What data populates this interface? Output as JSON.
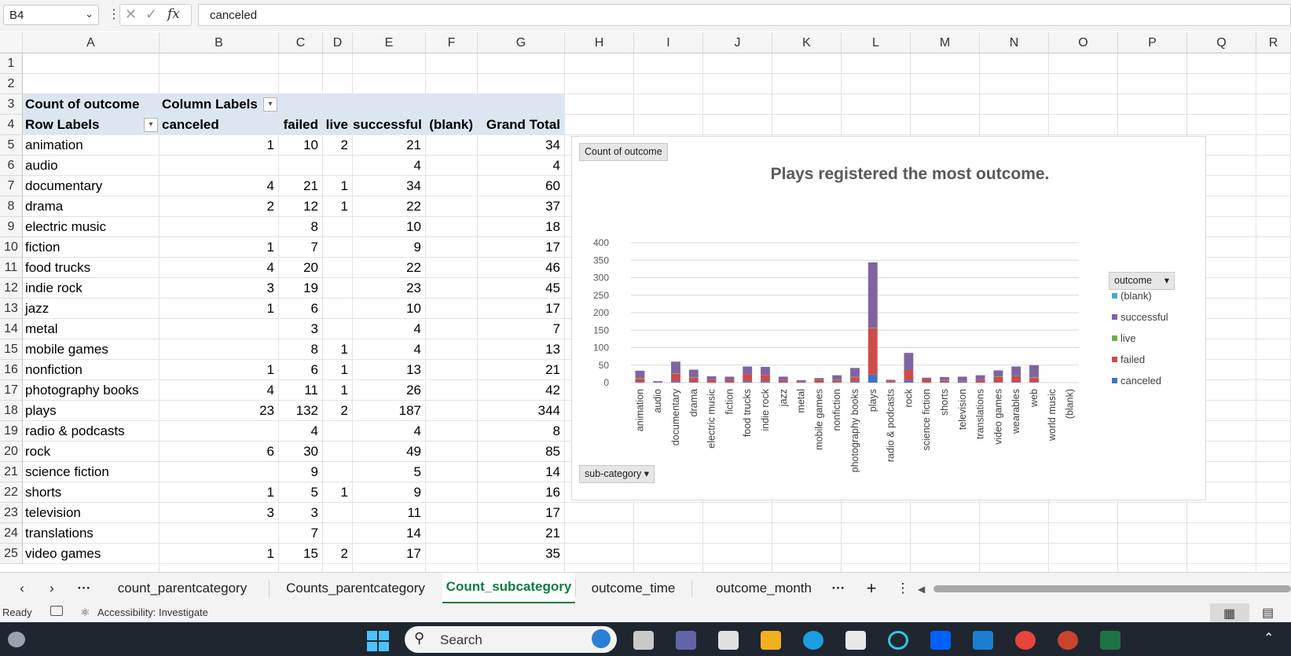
{
  "formula_bar": {
    "name_box": "B4",
    "value": "canceled"
  },
  "columns": [
    "A",
    "B",
    "C",
    "D",
    "E",
    "F",
    "G",
    "H",
    "I",
    "J",
    "K",
    "L",
    "M",
    "N",
    "O",
    "P",
    "Q",
    "R"
  ],
  "rows": [
    "1",
    "2",
    "3",
    "4",
    "5",
    "6",
    "7",
    "8",
    "9",
    "10",
    "11",
    "12",
    "13",
    "14",
    "15",
    "16",
    "17",
    "18",
    "19",
    "20",
    "21",
    "22",
    "23",
    "24",
    "25"
  ],
  "pivot": {
    "a3": "Count of outcome",
    "b3": "Column Labels",
    "a4": "Row Labels",
    "headers": [
      "canceled",
      "failed",
      "live",
      "successful",
      "(blank)",
      "Grand Total"
    ],
    "data": [
      {
        "label": "animation",
        "canceled": "1",
        "failed": "10",
        "live": "2",
        "successful": "21",
        "total": "34"
      },
      {
        "label": "audio",
        "canceled": "",
        "failed": "",
        "live": "",
        "successful": "4",
        "total": "4"
      },
      {
        "label": "documentary",
        "canceled": "4",
        "failed": "21",
        "live": "1",
        "successful": "34",
        "total": "60"
      },
      {
        "label": "drama",
        "canceled": "2",
        "failed": "12",
        "live": "1",
        "successful": "22",
        "total": "37"
      },
      {
        "label": "electric music",
        "canceled": "",
        "failed": "8",
        "live": "",
        "successful": "10",
        "total": "18"
      },
      {
        "label": "fiction",
        "canceled": "1",
        "failed": "7",
        "live": "",
        "successful": "9",
        "total": "17"
      },
      {
        "label": "food trucks",
        "canceled": "4",
        "failed": "20",
        "live": "",
        "successful": "22",
        "total": "46"
      },
      {
        "label": "indie rock",
        "canceled": "3",
        "failed": "19",
        "live": "",
        "successful": "23",
        "total": "45"
      },
      {
        "label": "jazz",
        "canceled": "1",
        "failed": "6",
        "live": "",
        "successful": "10",
        "total": "17"
      },
      {
        "label": "metal",
        "canceled": "",
        "failed": "3",
        "live": "",
        "successful": "4",
        "total": "7"
      },
      {
        "label": "mobile games",
        "canceled": "",
        "failed": "8",
        "live": "1",
        "successful": "4",
        "total": "13"
      },
      {
        "label": "nonfiction",
        "canceled": "1",
        "failed": "6",
        "live": "1",
        "successful": "13",
        "total": "21"
      },
      {
        "label": "photography books",
        "canceled": "4",
        "failed": "11",
        "live": "1",
        "successful": "26",
        "total": "42"
      },
      {
        "label": "plays",
        "canceled": "23",
        "failed": "132",
        "live": "2",
        "successful": "187",
        "total": "344"
      },
      {
        "label": "radio & podcasts",
        "canceled": "",
        "failed": "4",
        "live": "",
        "successful": "4",
        "total": "8"
      },
      {
        "label": "rock",
        "canceled": "6",
        "failed": "30",
        "live": "",
        "successful": "49",
        "total": "85"
      },
      {
        "label": "science fiction",
        "canceled": "",
        "failed": "9",
        "live": "",
        "successful": "5",
        "total": "14"
      },
      {
        "label": "shorts",
        "canceled": "1",
        "failed": "5",
        "live": "1",
        "successful": "9",
        "total": "16"
      },
      {
        "label": "television",
        "canceled": "3",
        "failed": "3",
        "live": "",
        "successful": "11",
        "total": "17"
      },
      {
        "label": "translations",
        "canceled": "",
        "failed": "7",
        "live": "",
        "successful": "14",
        "total": "21"
      },
      {
        "label": "video games",
        "canceled": "1",
        "failed": "15",
        "live": "2",
        "successful": "17",
        "total": "35"
      }
    ]
  },
  "chart": {
    "field_value_button": "Count  of outcome",
    "axis_field_button": "sub-category",
    "legend_field_button": "outcome"
  },
  "chart_data": {
    "type": "bar",
    "stacked": true,
    "title": "Plays registered the most outcome.",
    "ylim": [
      0,
      400
    ],
    "yticks": [
      0,
      50,
      100,
      150,
      200,
      250,
      300,
      350,
      400
    ],
    "categories": [
      "animation",
      "audio",
      "documentary",
      "drama",
      "electric music",
      "fiction",
      "food trucks",
      "indie rock",
      "jazz",
      "metal",
      "mobile games",
      "nonfiction",
      "photography books",
      "plays",
      "radio & podcasts",
      "rock",
      "science fiction",
      "shorts",
      "television",
      "translations",
      "video games",
      "wearables",
      "web",
      "world music",
      "(blank)"
    ],
    "series": [
      {
        "name": "canceled",
        "color": "#4472c4",
        "values": [
          1,
          0,
          4,
          2,
          0,
          1,
          4,
          3,
          1,
          0,
          0,
          1,
          4,
          23,
          0,
          6,
          0,
          1,
          3,
          0,
          1,
          2,
          2,
          0,
          0
        ]
      },
      {
        "name": "failed",
        "color": "#d04a4a",
        "values": [
          10,
          0,
          21,
          12,
          8,
          7,
          20,
          19,
          6,
          3,
          8,
          6,
          11,
          132,
          4,
          30,
          9,
          5,
          3,
          7,
          15,
          16,
          12,
          0,
          0
        ]
      },
      {
        "name": "live",
        "color": "#70ad47",
        "values": [
          2,
          0,
          1,
          1,
          0,
          0,
          0,
          0,
          0,
          0,
          1,
          1,
          1,
          2,
          0,
          0,
          0,
          1,
          0,
          0,
          2,
          1,
          1,
          0,
          0
        ]
      },
      {
        "name": "successful",
        "color": "#8064a2",
        "values": [
          21,
          4,
          34,
          22,
          10,
          9,
          22,
          23,
          10,
          4,
          4,
          13,
          26,
          187,
          4,
          49,
          5,
          9,
          11,
          14,
          17,
          27,
          35,
          0,
          0
        ]
      },
      {
        "name": "(blank)",
        "color": "#4bacc6",
        "values": [
          0,
          0,
          0,
          0,
          0,
          0,
          0,
          0,
          0,
          0,
          0,
          0,
          0,
          0,
          0,
          0,
          0,
          0,
          0,
          0,
          0,
          0,
          0,
          0,
          0
        ]
      }
    ],
    "legend": [
      "(blank)",
      "successful",
      "live",
      "failed",
      "canceled"
    ],
    "legend_position": "right"
  },
  "sheet_tabs": [
    "count_parentcategory",
    "Counts_parentcategory",
    "Count_subcategory",
    "outcome_time",
    "outcome_month"
  ],
  "active_tab": "Count_subcategory",
  "status": {
    "ready": "Ready",
    "accessibility": "Accessibility: Investigate"
  },
  "taskbar": {
    "search_label": "Search"
  }
}
